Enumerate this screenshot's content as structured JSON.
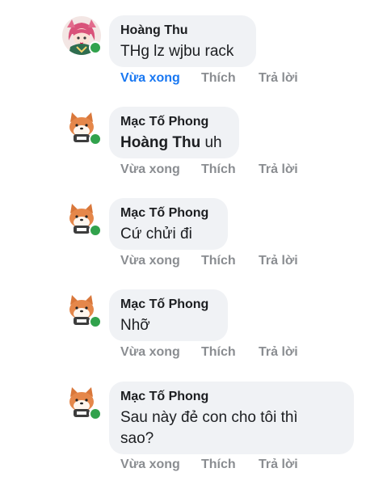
{
  "comments": [
    {
      "author": "Hoàng Thu",
      "mention": "",
      "text": "THg lz wjbu rack",
      "time": "Vừa xong",
      "like": "Thích",
      "reply": "Trả lời",
      "avatar_icon": "anime-girl-avatar",
      "online": true
    },
    {
      "author": "Mạc Tố Phong",
      "mention": "Hoàng Thu",
      "text": " uh",
      "time": "Vừa xong",
      "like": "Thích",
      "reply": "Trả lời",
      "avatar_icon": "shiba-dog-avatar",
      "online": true
    },
    {
      "author": "Mạc Tố Phong",
      "mention": "",
      "text": "Cứ chửi đi",
      "time": "Vừa xong",
      "like": "Thích",
      "reply": "Trả lời",
      "avatar_icon": "shiba-dog-avatar",
      "online": true
    },
    {
      "author": "Mạc Tố Phong",
      "mention": "",
      "text": "Nhỡ",
      "time": "Vừa xong",
      "like": "Thích",
      "reply": "Trả lời",
      "avatar_icon": "shiba-dog-avatar",
      "online": true
    },
    {
      "author": "Mạc Tố Phong",
      "mention": "",
      "text": "Sau này đẻ con cho tôi thì sao?",
      "time": "Vừa xong",
      "like": "Thích",
      "reply": "Trả lời",
      "avatar_icon": "shiba-dog-avatar",
      "online": true
    }
  ],
  "colors": {
    "bubble": "#f0f2f5",
    "text": "#1c1e21",
    "action_gray": "#8a8d91",
    "action_blue": "#1877f2",
    "online_green": "#31a24c"
  }
}
